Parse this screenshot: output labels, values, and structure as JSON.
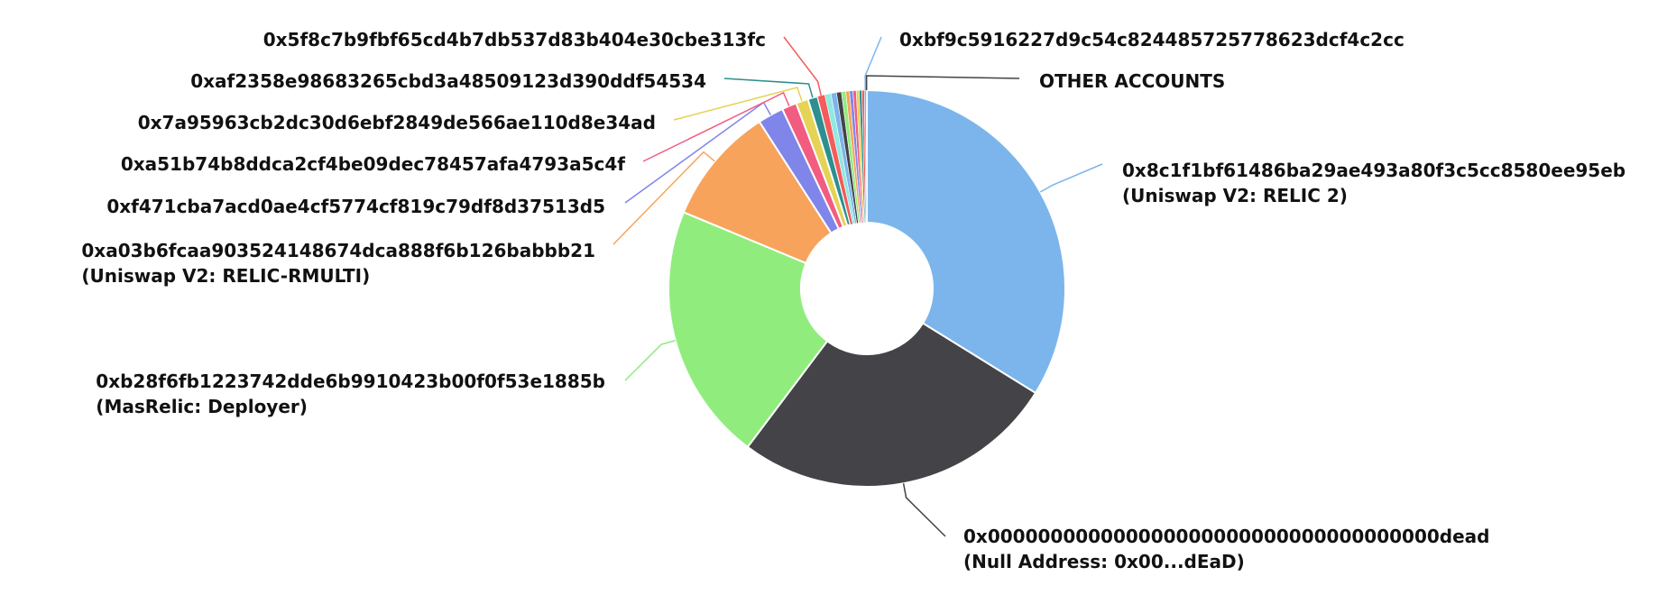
{
  "chart_data": {
    "type": "pie",
    "donut": true,
    "title": "",
    "slices": [
      {
        "address": "0x8c1f1bf61486ba29ae493a80f3c5cc8580ee95eb",
        "tag": "(Uniswap V2: RELIC 2)",
        "value": 33.8,
        "color": "#7cb5ec"
      },
      {
        "address": "0x000000000000000000000000000000000000dead",
        "tag": "(Null Address: 0x00...dEaD)",
        "value": 26.4,
        "color": "#434348"
      },
      {
        "address": "0xb28f6fb1223742dde6b9910423b00f0f53e1885b",
        "tag": "(MasRelic: Deployer)",
        "value": 21.0,
        "color": "#90ed7d"
      },
      {
        "address": "0xa03b6fcaa903524148674dca888f6b126babbb21",
        "tag": "(Uniswap V2: RELIC-RMULTI)",
        "value": 9.6,
        "color": "#f7a35c"
      },
      {
        "address": "0xf471cba7acd0ae4cf5774cf819c79df8d37513d5",
        "tag": "",
        "value": 2.1,
        "color": "#8085e9"
      },
      {
        "address": "0xa51b74b8ddca2cf4be09dec78457afa4793a5c4f",
        "tag": "",
        "value": 1.2,
        "color": "#f15c80"
      },
      {
        "address": "0x7a95963cb2dc30d6ebf2849de566ae110d8e34ad",
        "tag": "",
        "value": 1.0,
        "color": "#e4d354"
      },
      {
        "address": "0xaf2358e98683265cbd3a48509123d390ddf54534",
        "tag": "",
        "value": 0.8,
        "color": "#2b908f"
      },
      {
        "address": "0x5f8c7b9fbf65cd4b7db537d83b404e30cbe313fc",
        "tag": "",
        "value": 0.6,
        "color": "#f45b5b"
      },
      {
        "address": "",
        "tag": "",
        "value": 0.5,
        "color": "#91e8e1"
      },
      {
        "address": "",
        "tag": "",
        "value": 0.45,
        "color": "#7cb5ec"
      },
      {
        "address": "",
        "tag": "",
        "value": 0.4,
        "color": "#434348"
      },
      {
        "address": "",
        "tag": "",
        "value": 0.35,
        "color": "#90ed7d"
      },
      {
        "address": "",
        "tag": "",
        "value": 0.3,
        "color": "#f7a35c"
      },
      {
        "address": "",
        "tag": "",
        "value": 0.28,
        "color": "#8085e9"
      },
      {
        "address": "",
        "tag": "",
        "value": 0.26,
        "color": "#f15c80"
      },
      {
        "address": "",
        "tag": "",
        "value": 0.24,
        "color": "#e4d354"
      },
      {
        "address": "",
        "tag": "",
        "value": 0.22,
        "color": "#2b908f"
      },
      {
        "address": "",
        "tag": "",
        "value": 0.2,
        "color": "#f45b5b"
      },
      {
        "address": "0xbf9c5916227d9c54c824485725778623dcf4c2cc",
        "tag": "",
        "value": 0.15,
        "color": "#7cb5ec"
      },
      {
        "address": "OTHER ACCOUNTS",
        "tag": "",
        "value": 0.05,
        "color": "#434348"
      }
    ]
  }
}
